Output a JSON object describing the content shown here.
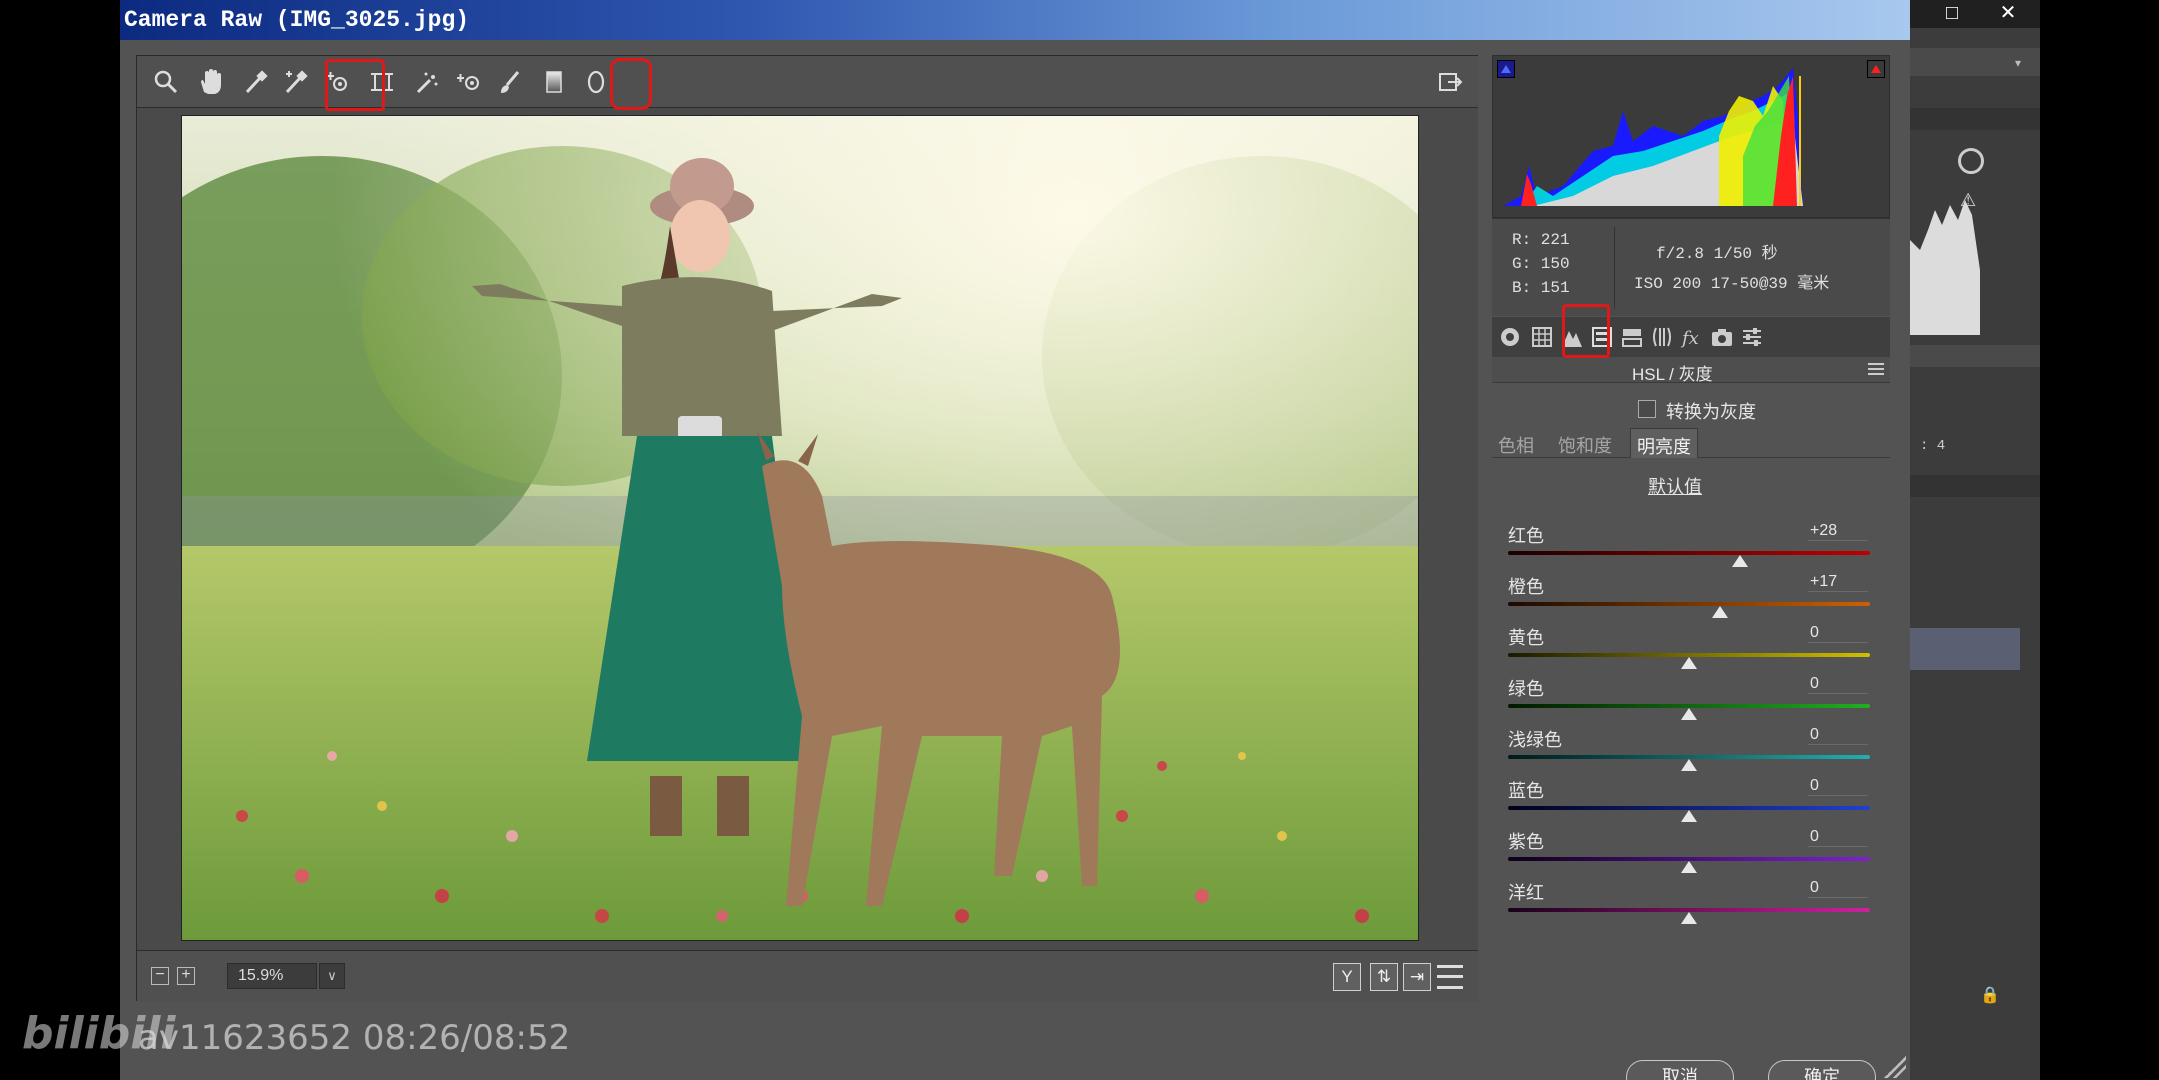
{
  "window": {
    "title": "Camera Raw (IMG_3025.jpg)"
  },
  "toolbar": {
    "tools": [
      "zoom-tool-icon",
      "hand-tool-icon",
      "white-balance-icon",
      "color-sampler-icon",
      "targeted-adjustment-icon",
      "transform-icon",
      "spot-removal-icon",
      "red-eye-icon",
      "adjustment-brush-icon",
      "graduated-filter-icon",
      "radial-filter-icon"
    ],
    "open_prefs_icon": "open-preferences-icon"
  },
  "bottom_bar": {
    "zoom_value": "15.9%",
    "zoom_dropdown_icon": "chevron-down-icon"
  },
  "readout": {
    "r": "R: 221",
    "g": "G: 150",
    "b": "B: 151",
    "exposure": "f/2.8  1/50 秒",
    "iso_lens": "ISO 200  17-50@39 毫米"
  },
  "panel": {
    "title": "HSL / 灰度",
    "grayscale_label": "转换为灰度",
    "tabs": [
      "色相",
      "饱和度",
      "明亮度"
    ],
    "active_tab": "明亮度",
    "defaults_label": "默认值",
    "sliders": [
      {
        "label": "红色",
        "value": "+28",
        "level": 28
      },
      {
        "label": "橙色",
        "value": "+17",
        "level": 17
      },
      {
        "label": "黄色",
        "value": "0",
        "level": 0
      },
      {
        "label": "绿色",
        "value": "0",
        "level": 0
      },
      {
        "label": "浅绿色",
        "value": "0",
        "level": 0
      },
      {
        "label": "蓝色",
        "value": "0",
        "level": 0
      },
      {
        "label": "紫色",
        "value": "0",
        "level": 0
      },
      {
        "label": "洋红",
        "value": "0",
        "level": 0
      }
    ]
  },
  "buttons": {
    "cancel": "取消",
    "ok": "确定"
  },
  "watermark": {
    "logo": "bilibili",
    "text": "av11623652 08:26/08:52"
  },
  "background_app": {
    "readout_suffix": ": 4"
  },
  "colors": {
    "accent_red": "#e01818",
    "title_bar": "#1c3f98"
  }
}
